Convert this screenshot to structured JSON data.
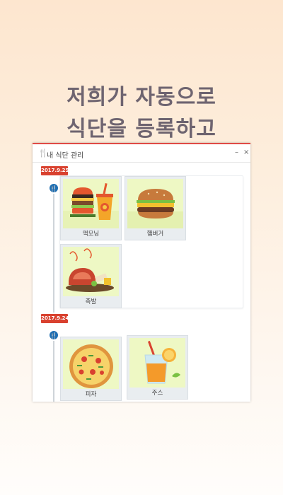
{
  "headline": {
    "line1": "저희가 자동으로",
    "line2": "식단을 등록하고"
  },
  "window": {
    "title": "내 식단 관리",
    "title_icon": "fork-knife-icon",
    "minimize": "–",
    "close": "×"
  },
  "meal_groups": [
    {
      "date": "2017.9.25",
      "items": [
        {
          "label": "맥모닝",
          "icon": "burger-and-drink"
        },
        {
          "label": "햄버거",
          "icon": "hamburger"
        },
        {
          "label": "족발",
          "icon": "meat-plate"
        }
      ]
    },
    {
      "date": "2017.9.24",
      "items": [
        {
          "label": "피자",
          "icon": "pizza"
        },
        {
          "label": "주스",
          "icon": "juice"
        }
      ]
    }
  ],
  "colors": {
    "accent_red": "#d9412f",
    "pin_blue": "#1f6fb3",
    "headline": "#6e6470",
    "food_bg": "#f0f8cf"
  }
}
